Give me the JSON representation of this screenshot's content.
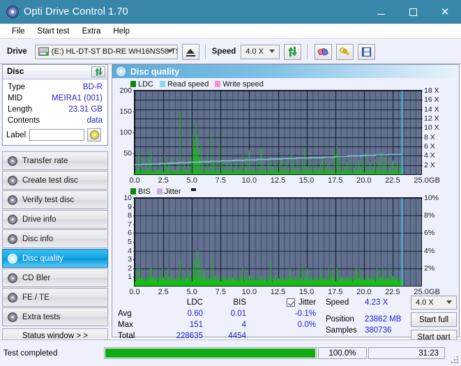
{
  "window": {
    "title": "Opti Drive Control 1.70",
    "icon": "disc-icon",
    "minimize": "—",
    "maximize": "□",
    "close": "✕"
  },
  "menu": {
    "items": [
      "File",
      "Start test",
      "Extra",
      "Help"
    ]
  },
  "toolbar": {
    "drive_label": "Drive",
    "drive_value": "(E:)   HL-DT-ST BD-RE  WH16NS58 TST4",
    "eject_label": "eject-button",
    "speed_label": "Speed",
    "speed_value": "4.0 X",
    "refresh_label": "refresh-button",
    "eraser_label": "erase-button",
    "key_label": "key-button",
    "save_label": "save-button"
  },
  "disc": {
    "header": "Disc",
    "rows": [
      {
        "key": "Type",
        "value": "BD-R"
      },
      {
        "key": "MID",
        "value": "MEIRA1 (001)"
      },
      {
        "key": "Length",
        "value": "23.31 GB"
      },
      {
        "key": "Contents",
        "value": "data"
      }
    ],
    "label_key": "Label",
    "label_value": "",
    "label_placeholder": ""
  },
  "nav": {
    "items": [
      {
        "label": "Transfer rate",
        "selected": false
      },
      {
        "label": "Create test disc",
        "selected": false
      },
      {
        "label": "Verify test disc",
        "selected": false
      },
      {
        "label": "Drive info",
        "selected": false
      },
      {
        "label": "Disc info",
        "selected": false
      },
      {
        "label": "Disc quality",
        "selected": true
      },
      {
        "label": "CD Bler",
        "selected": false
      },
      {
        "label": "FE / TE",
        "selected": false
      },
      {
        "label": "Extra tests",
        "selected": false
      }
    ],
    "status_window": "Status window > >"
  },
  "panel": {
    "title": "Disc quality"
  },
  "stats": {
    "col_headers": [
      "",
      "LDC",
      "BIS",
      "Jitter"
    ],
    "jitter_checkbox_checked": true,
    "jitter_label": "Jitter",
    "rows": [
      {
        "label": "Avg",
        "ldc": "0.60",
        "bis": "0.01",
        "jitter": "-0.1%"
      },
      {
        "label": "Max",
        "ldc": "151",
        "bis": "4",
        "jitter": "0.0%"
      },
      {
        "label": "Total",
        "ldc": "228635",
        "bis": "4454",
        "jitter": ""
      }
    ],
    "speed_key": "Speed",
    "speed_value": "4.23 X",
    "position_key": "Position",
    "position_value": "23862 MB",
    "samples_key": "Samples",
    "samples_value": "380736",
    "speed_select": "4.0 X",
    "start_full": "Start full",
    "start_part": "Start part"
  },
  "statusbar": {
    "text": "Test completed",
    "progress_pct": "100.0%",
    "progress_value": 100,
    "elapsed": "31:23"
  },
  "chart_data": [
    {
      "type": "line",
      "name": "ldc-chart",
      "title": "",
      "xlabel": "GB",
      "ylabel": "",
      "xlim": [
        0,
        25
      ],
      "xticks": [
        0.0,
        2.5,
        5.0,
        7.5,
        10.0,
        12.5,
        15.0,
        17.5,
        20.0,
        22.5,
        25.0
      ],
      "xticklabels": [
        "0.0",
        "2.5",
        "5.0",
        "7.5",
        "10.0",
        "12.5",
        "15.0",
        "17.5",
        "20.0",
        "22.5",
        "25.0"
      ],
      "ylim": [
        0,
        200
      ],
      "yticks": [
        50,
        100,
        150,
        200
      ],
      "yticklabels": [
        "50",
        "100",
        "150",
        "200"
      ],
      "y2lim": [
        0,
        18
      ],
      "y2ticks": [
        2,
        4,
        6,
        8,
        10,
        12,
        14,
        16,
        18
      ],
      "y2ticklabels": [
        "2 X",
        "4 X",
        "6 X",
        "8 X",
        "10 X",
        "12 X",
        "14 X",
        "16 X",
        "18 X"
      ],
      "grid": true,
      "legend": [
        "LDC",
        "Read speed",
        "Write speed"
      ],
      "legend_colors": [
        "#108410",
        "#8fd6f2",
        "#f48fd6"
      ],
      "data_end_x": 23.3,
      "series": [
        {
          "name": "LDC",
          "color": "#12c112",
          "style": "impulse",
          "baseline": 6,
          "peaks": [
            [
              0.15,
              18
            ],
            [
              0.3,
              62
            ],
            [
              0.45,
              12
            ],
            [
              0.6,
              40
            ],
            [
              0.75,
              9
            ],
            [
              0.95,
              30
            ],
            [
              1.1,
              14
            ],
            [
              1.3,
              44
            ],
            [
              1.45,
              60
            ],
            [
              1.6,
              11
            ],
            [
              1.8,
              20
            ],
            [
              2.0,
              10
            ],
            [
              2.2,
              26
            ],
            [
              2.35,
              8
            ],
            [
              2.55,
              47
            ],
            [
              2.7,
              30
            ],
            [
              2.85,
              14
            ],
            [
              3.0,
              23
            ],
            [
              3.2,
              40
            ],
            [
              3.35,
              10
            ],
            [
              3.55,
              12
            ],
            [
              3.75,
              22
            ],
            [
              3.95,
              151
            ],
            [
              4.1,
              18
            ],
            [
              4.3,
              30
            ],
            [
              4.5,
              12
            ],
            [
              4.7,
              26
            ],
            [
              4.9,
              42
            ],
            [
              5.05,
              96
            ],
            [
              5.15,
              82
            ],
            [
              5.25,
              60
            ],
            [
              5.35,
              125
            ],
            [
              5.45,
              92
            ],
            [
              5.55,
              55
            ],
            [
              5.65,
              40
            ],
            [
              5.8,
              70
            ],
            [
              5.95,
              26
            ],
            [
              6.1,
              18
            ],
            [
              6.3,
              45
            ],
            [
              6.5,
              20
            ],
            [
              6.7,
              99
            ],
            [
              6.85,
              36
            ],
            [
              7.05,
              24
            ],
            [
              7.25,
              14
            ],
            [
              7.45,
              70
            ],
            [
              7.6,
              28
            ],
            [
              7.8,
              16
            ],
            [
              8.0,
              33
            ],
            [
              8.2,
              12
            ],
            [
              8.4,
              26
            ],
            [
              8.6,
              18
            ],
            [
              8.8,
              30
            ],
            [
              9.0,
              13
            ],
            [
              9.2,
              21
            ],
            [
              9.4,
              45
            ],
            [
              9.6,
              17
            ],
            [
              9.8,
              27
            ],
            [
              10.0,
              58
            ],
            [
              10.2,
              20
            ],
            [
              10.4,
              12
            ],
            [
              10.6,
              35
            ],
            [
              10.8,
              18
            ],
            [
              11.0,
              62
            ],
            [
              11.2,
              22
            ],
            [
              11.4,
              14
            ],
            [
              11.6,
              40
            ],
            [
              11.8,
              26
            ],
            [
              12.0,
              19
            ],
            [
              12.2,
              31
            ],
            [
              12.4,
              16
            ],
            [
              12.6,
              24
            ],
            [
              12.8,
              44
            ],
            [
              13.0,
              18
            ],
            [
              13.2,
              30
            ],
            [
              13.4,
              13
            ],
            [
              13.6,
              50
            ],
            [
              13.8,
              22
            ],
            [
              14.0,
              16
            ],
            [
              14.2,
              36
            ],
            [
              14.4,
              20
            ],
            [
              14.6,
              27
            ],
            [
              14.8,
              63
            ],
            [
              15.0,
              18
            ],
            [
              15.2,
              30
            ],
            [
              15.4,
              14
            ],
            [
              15.6,
              42
            ],
            [
              15.8,
              21
            ],
            [
              16.0,
              16
            ],
            [
              16.2,
              28
            ],
            [
              16.4,
              38
            ],
            [
              16.6,
              19
            ],
            [
              16.8,
              24
            ],
            [
              17.0,
              33
            ],
            [
              17.2,
              15
            ],
            [
              17.4,
              58
            ],
            [
              17.55,
              70
            ],
            [
              17.7,
              44
            ],
            [
              17.9,
              26
            ],
            [
              18.1,
              36
            ],
            [
              18.3,
              18
            ],
            [
              18.5,
              29
            ],
            [
              18.7,
              21
            ],
            [
              18.9,
              40
            ],
            [
              19.1,
              16
            ],
            [
              19.3,
              27
            ],
            [
              19.5,
              34
            ],
            [
              19.7,
              19
            ],
            [
              19.9,
              23
            ],
            [
              20.1,
              48
            ],
            [
              20.3,
              17
            ],
            [
              20.5,
              28
            ],
            [
              20.7,
              20
            ],
            [
              20.9,
              35
            ],
            [
              21.1,
              15
            ],
            [
              21.3,
              30
            ],
            [
              21.5,
              55
            ],
            [
              21.7,
              22
            ],
            [
              21.9,
              41
            ],
            [
              22.1,
              18
            ],
            [
              22.3,
              26
            ],
            [
              22.5,
              33
            ],
            [
              22.7,
              20
            ],
            [
              22.9,
              29
            ],
            [
              23.1,
              24
            ],
            [
              23.25,
              15
            ]
          ]
        },
        {
          "name": "Read speed",
          "color": "#8fd6f2",
          "style": "step",
          "points": [
            [
              0.0,
              2.0
            ],
            [
              0.6,
              2.1
            ],
            [
              1.4,
              2.2
            ],
            [
              2.2,
              2.3
            ],
            [
              3.0,
              2.4
            ],
            [
              3.9,
              2.5
            ],
            [
              4.8,
              2.6
            ],
            [
              5.7,
              2.7
            ],
            [
              6.6,
              2.8
            ],
            [
              7.6,
              2.9
            ],
            [
              8.6,
              3.0
            ],
            [
              9.6,
              3.1
            ],
            [
              10.7,
              3.2
            ],
            [
              11.8,
              3.3
            ],
            [
              12.9,
              3.4
            ],
            [
              14.1,
              3.5
            ],
            [
              15.3,
              3.6
            ],
            [
              16.5,
              3.7
            ],
            [
              17.5,
              3.85
            ],
            [
              18.6,
              3.95
            ],
            [
              19.8,
              4.05
            ],
            [
              21.0,
              4.15
            ],
            [
              22.1,
              4.25
            ],
            [
              23.3,
              4.3
            ]
          ]
        },
        {
          "name": "marker",
          "color": "#3ad4f5",
          "style": "vline",
          "x": 23.3
        }
      ]
    },
    {
      "type": "line",
      "name": "bis-chart",
      "title": "",
      "xlabel": "GB",
      "ylabel": "",
      "xlim": [
        0,
        25
      ],
      "xticks": [
        0.0,
        2.5,
        5.0,
        7.5,
        10.0,
        12.5,
        15.0,
        17.5,
        20.0,
        22.5,
        25.0
      ],
      "xticklabels": [
        "0.0",
        "2.5",
        "5.0",
        "7.5",
        "10.0",
        "12.5",
        "15.0",
        "17.5",
        "20.0",
        "22.5",
        "25.0"
      ],
      "ylim": [
        0,
        10
      ],
      "yticks": [
        1,
        2,
        3,
        4,
        5,
        6,
        7,
        8,
        9,
        10
      ],
      "yticklabels": [
        "1",
        "2",
        "3",
        "4",
        "5",
        "6",
        "7",
        "8",
        "9",
        "10"
      ],
      "y2lim": [
        0,
        10
      ],
      "y2ticks": [
        2,
        4,
        6,
        8,
        10
      ],
      "y2ticklabels": [
        "2%",
        "4%",
        "6%",
        "8%",
        "10%"
      ],
      "grid": true,
      "legend": [
        "BIS",
        "Jitter"
      ],
      "legend_colors": [
        "#108410",
        "#cdaedd"
      ],
      "data_end_x": 23.3,
      "series": [
        {
          "name": "BIS",
          "color": "#12c112",
          "style": "impulse",
          "baseline": 1,
          "peaks": [
            [
              0.25,
              2
            ],
            [
              0.45,
              2
            ],
            [
              1.35,
              2
            ],
            [
              1.45,
              2
            ],
            [
              2.45,
              2
            ],
            [
              2.95,
              2
            ],
            [
              3.95,
              3
            ],
            [
              4.55,
              2
            ],
            [
              5.05,
              2
            ],
            [
              5.2,
              3
            ],
            [
              5.3,
              3
            ],
            [
              5.45,
              4
            ],
            [
              5.6,
              3
            ],
            [
              5.75,
              2
            ],
            [
              6.05,
              2
            ],
            [
              6.75,
              3
            ],
            [
              9.4,
              2
            ],
            [
              11.85,
              3
            ],
            [
              13.5,
              2
            ],
            [
              14.3,
              2
            ],
            [
              14.6,
              2
            ],
            [
              15.0,
              2
            ],
            [
              16.2,
              2
            ],
            [
              16.9,
              2
            ],
            [
              17.3,
              2
            ],
            [
              17.6,
              2
            ],
            [
              19.3,
              2
            ],
            [
              19.6,
              2
            ],
            [
              21.1,
              2
            ],
            [
              21.6,
              2
            ],
            [
              22.2,
              2
            ]
          ]
        },
        {
          "name": "marker",
          "color": "#3ad4f5",
          "style": "vline",
          "x": 23.3
        }
      ]
    }
  ]
}
